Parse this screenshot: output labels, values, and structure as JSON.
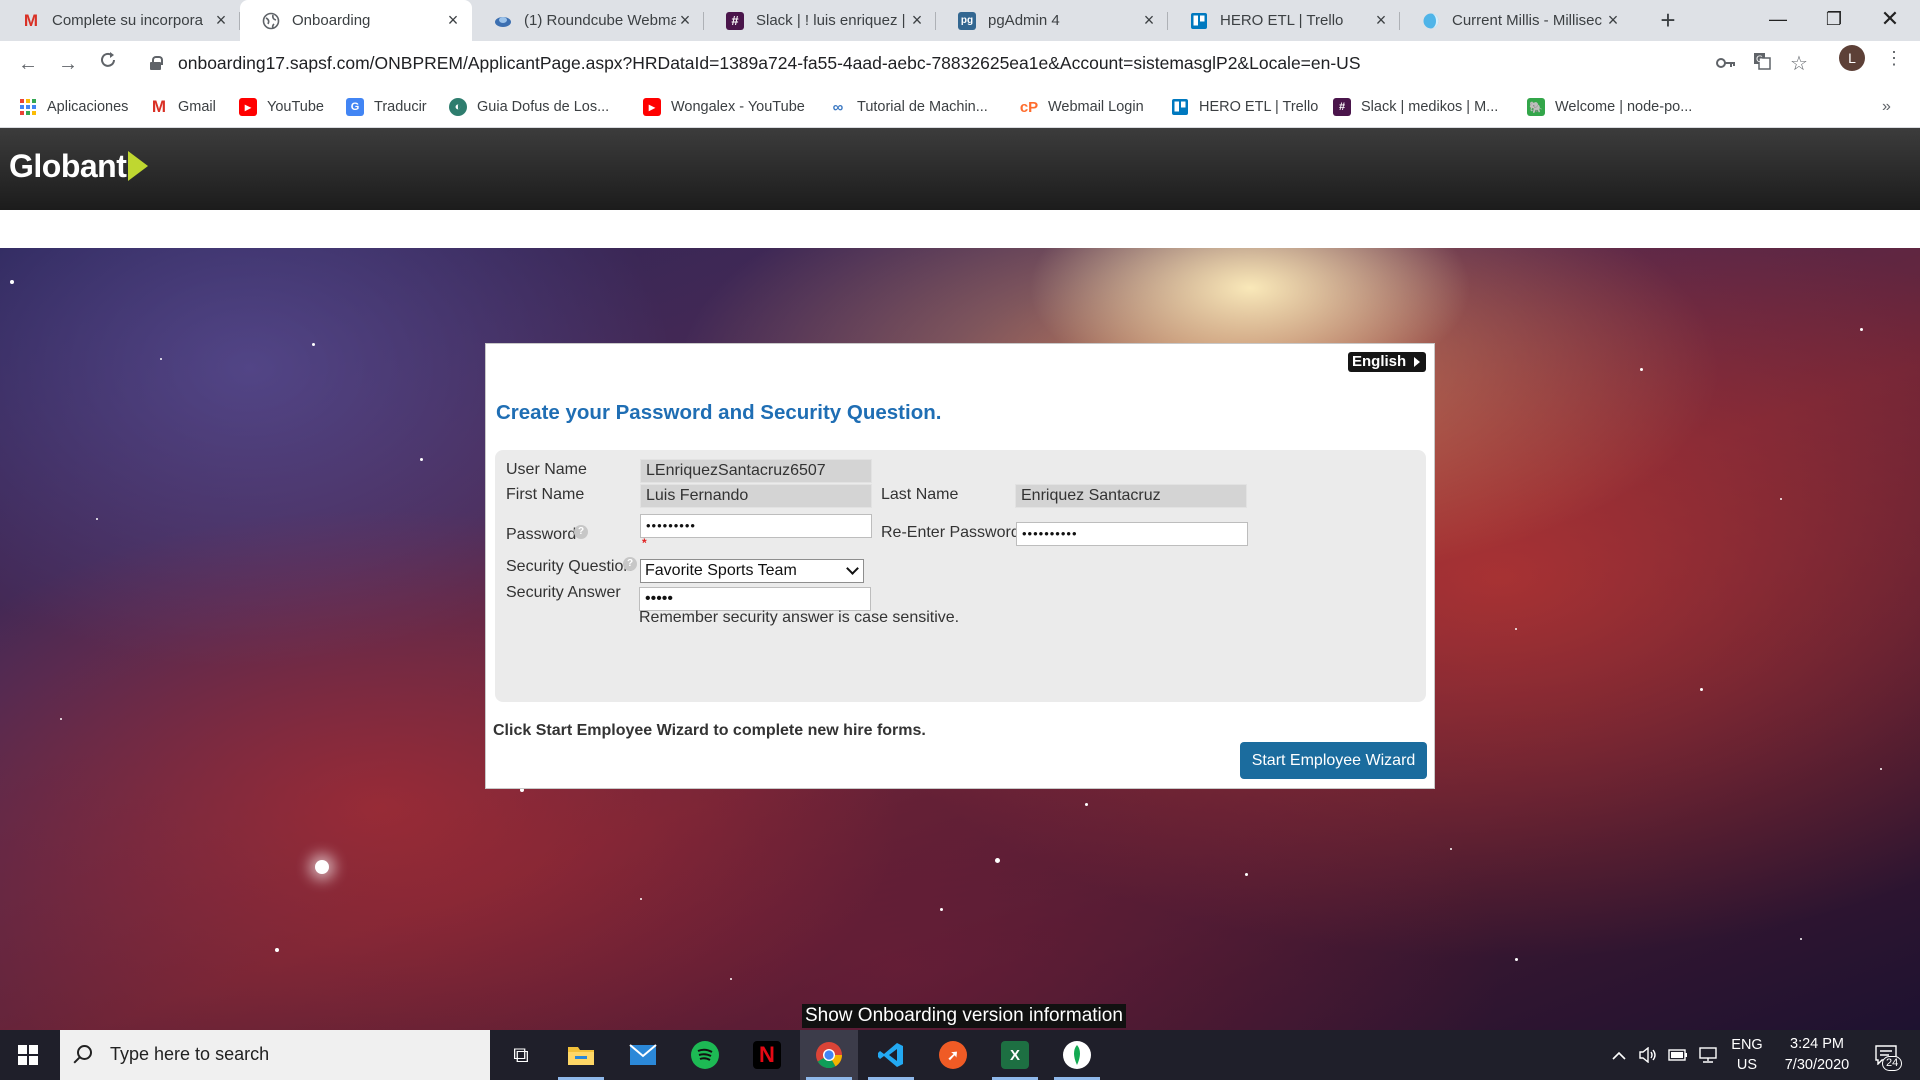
{
  "browser": {
    "tabs": [
      {
        "title": "Complete su incorpora",
        "icon": "gmail-icon",
        "active": false
      },
      {
        "title": "Onboarding",
        "icon": "globe-icon",
        "active": true
      },
      {
        "title": "(1) Roundcube Webma",
        "icon": "roundcube-icon",
        "active": false
      },
      {
        "title": "Slack | ! luis enriquez |",
        "icon": "slack-icon",
        "active": false
      },
      {
        "title": "pgAdmin 4",
        "icon": "pgadmin-icon",
        "active": false
      },
      {
        "title": "HERO ETL | Trello",
        "icon": "trello-icon",
        "active": false
      },
      {
        "title": "Current Millis - Millisec",
        "icon": "millis-icon",
        "active": false
      }
    ],
    "url": "onboarding17.sapsf.com/ONBPREM/ApplicantPage.aspx?HRDataId=1389a724-fa55-4aad-aebc-78832625ea1e&Account=sistemasglP2&Locale=en-US",
    "profile_initial": "L",
    "bookmarks": [
      {
        "label": "Aplicaciones",
        "icon": "apps-grid-icon"
      },
      {
        "label": "Gmail",
        "icon": "gmail-icon"
      },
      {
        "label": "YouTube",
        "icon": "youtube-icon"
      },
      {
        "label": "Traducir",
        "icon": "translate-icon"
      },
      {
        "label": "Guia Dofus de Los...",
        "icon": "dofus-icon"
      },
      {
        "label": "Wongalex - YouTube",
        "icon": "youtube-icon"
      },
      {
        "label": "Tutorial de Machin...",
        "icon": "link-icon"
      },
      {
        "label": "Webmail Login",
        "icon": "cpanel-icon"
      },
      {
        "label": "HERO ETL | Trello",
        "icon": "trello-icon"
      },
      {
        "label": "Slack | medikos | M...",
        "icon": "slack-icon"
      },
      {
        "label": "Welcome | node-po...",
        "icon": "node-icon"
      }
    ],
    "bookmarks_overflow": "»"
  },
  "page": {
    "logo_text": "Globant",
    "language_button": "English",
    "title": "Create your Password and Security Question.",
    "form": {
      "user_name_label": "User Name",
      "user_name_value": "LEnriquezSantacruz6507",
      "first_name_label": "First Name",
      "first_name_value": "Luis Fernando",
      "last_name_label": "Last Name",
      "last_name_value": "Enriquez Santacruz",
      "password_label": "Password",
      "password_value": "•••••••••",
      "reenter_password_label": "Re-Enter Password",
      "reenter_password_value": "••••••••••",
      "required_marker": "*",
      "help_glyph": "?",
      "security_question_label": "Security Question",
      "security_question_value": "Favorite Sports Team",
      "security_answer_label": "Security Answer",
      "security_answer_value": "•••••",
      "case_hint": "Remember security answer is case sensitive."
    },
    "instruction": "Click Start Employee Wizard to complete new hire forms.",
    "wizard_button": "Start Employee Wizard",
    "version_tooltip": "Show Onboarding version information"
  },
  "taskbar": {
    "search_placeholder": "Type here to search",
    "apps": [
      {
        "name": "task-view",
        "glyph": "⧉",
        "color": "#1f1f2a"
      },
      {
        "name": "file-explorer",
        "glyph": "",
        "color": "#f3c13a"
      },
      {
        "name": "mail",
        "glyph": "✉",
        "color": "#2b88d8"
      },
      {
        "name": "spotify",
        "glyph": "≋",
        "color": "#1db954"
      },
      {
        "name": "netflix",
        "glyph": "N",
        "color": "#000000"
      },
      {
        "name": "chrome",
        "glyph": "",
        "color": "#db4437"
      },
      {
        "name": "vscode",
        "glyph": "⟨⟩",
        "color": "#1f1f2a"
      },
      {
        "name": "postman",
        "glyph": "✈",
        "color": "#ef5b25"
      },
      {
        "name": "excel",
        "glyph": "X",
        "color": "#1d6f42"
      },
      {
        "name": "mongodb",
        "glyph": "❦",
        "color": "#ffffff"
      }
    ],
    "language_line1": "ENG",
    "language_line2": "US",
    "time": "3:24 PM",
    "date": "7/30/2020",
    "notification_count": "24"
  },
  "colors": {
    "title_blue": "#1f6eb4",
    "button_blue": "#1b6c9e",
    "logo_green": "#bfd730"
  }
}
